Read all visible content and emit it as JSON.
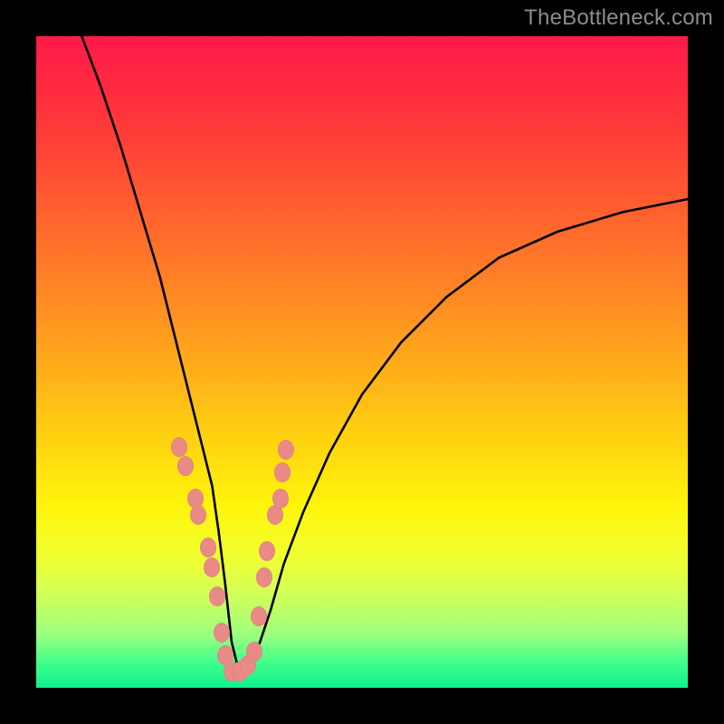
{
  "watermark": "TheBottleneck.com",
  "colors": {
    "marker": "#e98a87",
    "curve": "#000000",
    "page_bg": "#000000"
  },
  "chart_data": {
    "type": "line",
    "title": "",
    "xlabel": "",
    "ylabel": "",
    "xlim": [
      0,
      100
    ],
    "ylim": [
      0,
      100
    ],
    "grid": false,
    "legend": false,
    "note": "Axes are not labeled in the source image. x and y are scaled 0–100 from the plot-area bounding box (x left→right, y bottom→top). The single black curve drops from top-left to a minimum near x≈30 and rises toward the right edge at roughly y≈75. Salmon markers cluster on both flanks of the V near the minimum.",
    "series": [
      {
        "name": "curve",
        "x": [
          7,
          10,
          13,
          16,
          19,
          21,
          23,
          25,
          27,
          28,
          29,
          30,
          31,
          32,
          33,
          34,
          36,
          38,
          41,
          45,
          50,
          56,
          63,
          71,
          80,
          90,
          100
        ],
        "y": [
          100,
          92,
          83,
          73,
          63,
          55,
          47,
          39,
          31,
          24,
          16,
          7,
          3,
          2,
          3,
          6,
          12,
          19,
          27,
          36,
          45,
          53,
          60,
          66,
          70,
          73,
          75
        ]
      }
    ],
    "markers": {
      "name": "highlight-points",
      "x": [
        22.0,
        22.9,
        24.5,
        24.8,
        26.4,
        27.0,
        27.8,
        28.5,
        29.0,
        30.0,
        31.3,
        32.5,
        33.5,
        34.2,
        35.0,
        35.4,
        36.7,
        37.5,
        37.8,
        38.3
      ],
      "y": [
        37.0,
        34.0,
        29.0,
        26.5,
        21.5,
        18.5,
        14.0,
        8.5,
        5.0,
        2.5,
        2.5,
        3.5,
        5.5,
        11.0,
        17.0,
        21.0,
        26.5,
        29.0,
        33.0,
        36.5
      ]
    }
  }
}
